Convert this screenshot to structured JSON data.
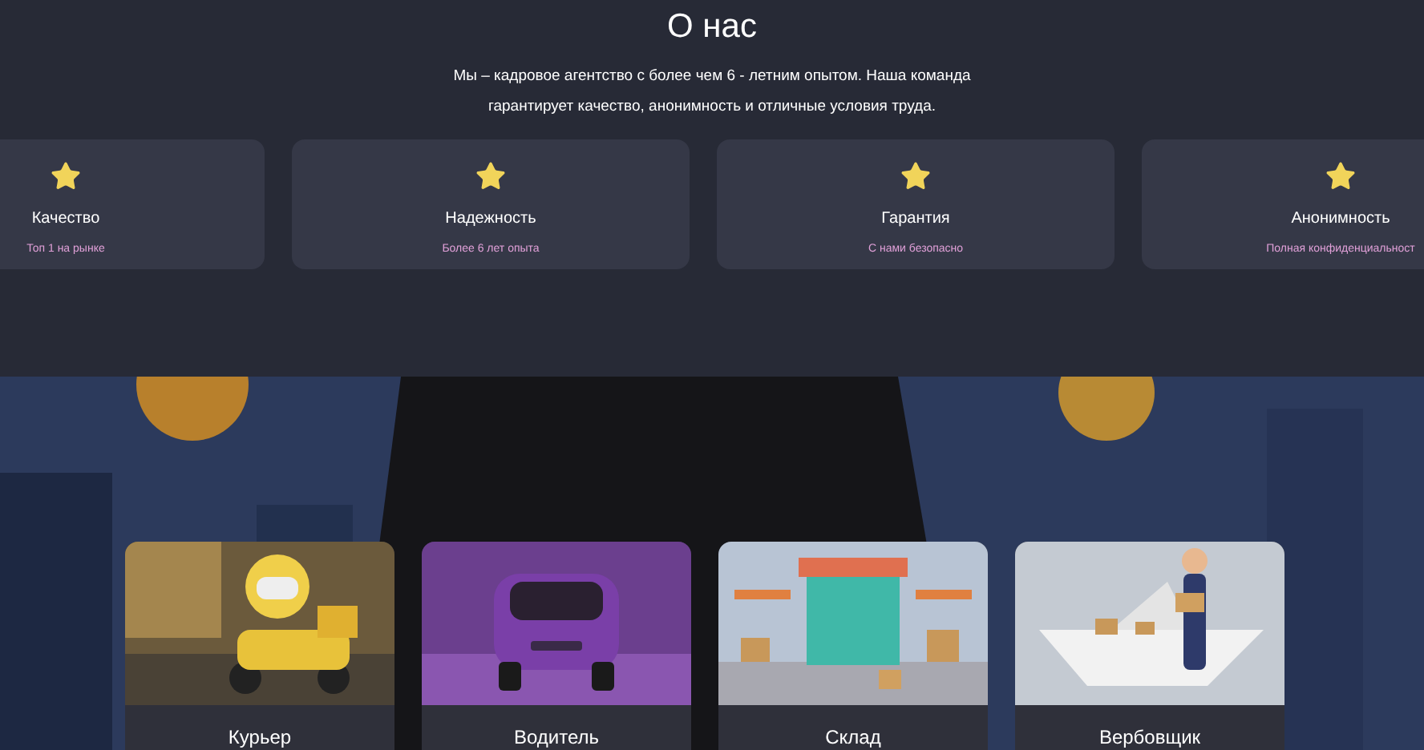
{
  "section": {
    "title": "О нас",
    "intro": "Мы – кадровое агентство с более чем 6 - летним опытом. Наша команда гарантирует качество, анонимность и отличные условия труда."
  },
  "features": [
    {
      "title": "Качество",
      "subtitle": "Топ 1 на рынке"
    },
    {
      "title": "Надежность",
      "subtitle": "Более 6 лет опыта"
    },
    {
      "title": "Гарантия",
      "subtitle": "С нами безопасно"
    },
    {
      "title": "Анонимность",
      "subtitle": "Полная конфиденциальност"
    }
  ],
  "services": [
    {
      "title": "Курьер",
      "kind": "courier"
    },
    {
      "title": "Водитель",
      "kind": "car"
    },
    {
      "title": "Склад",
      "kind": "warehouse"
    },
    {
      "title": "Вербовщик",
      "kind": "boat"
    }
  ]
}
